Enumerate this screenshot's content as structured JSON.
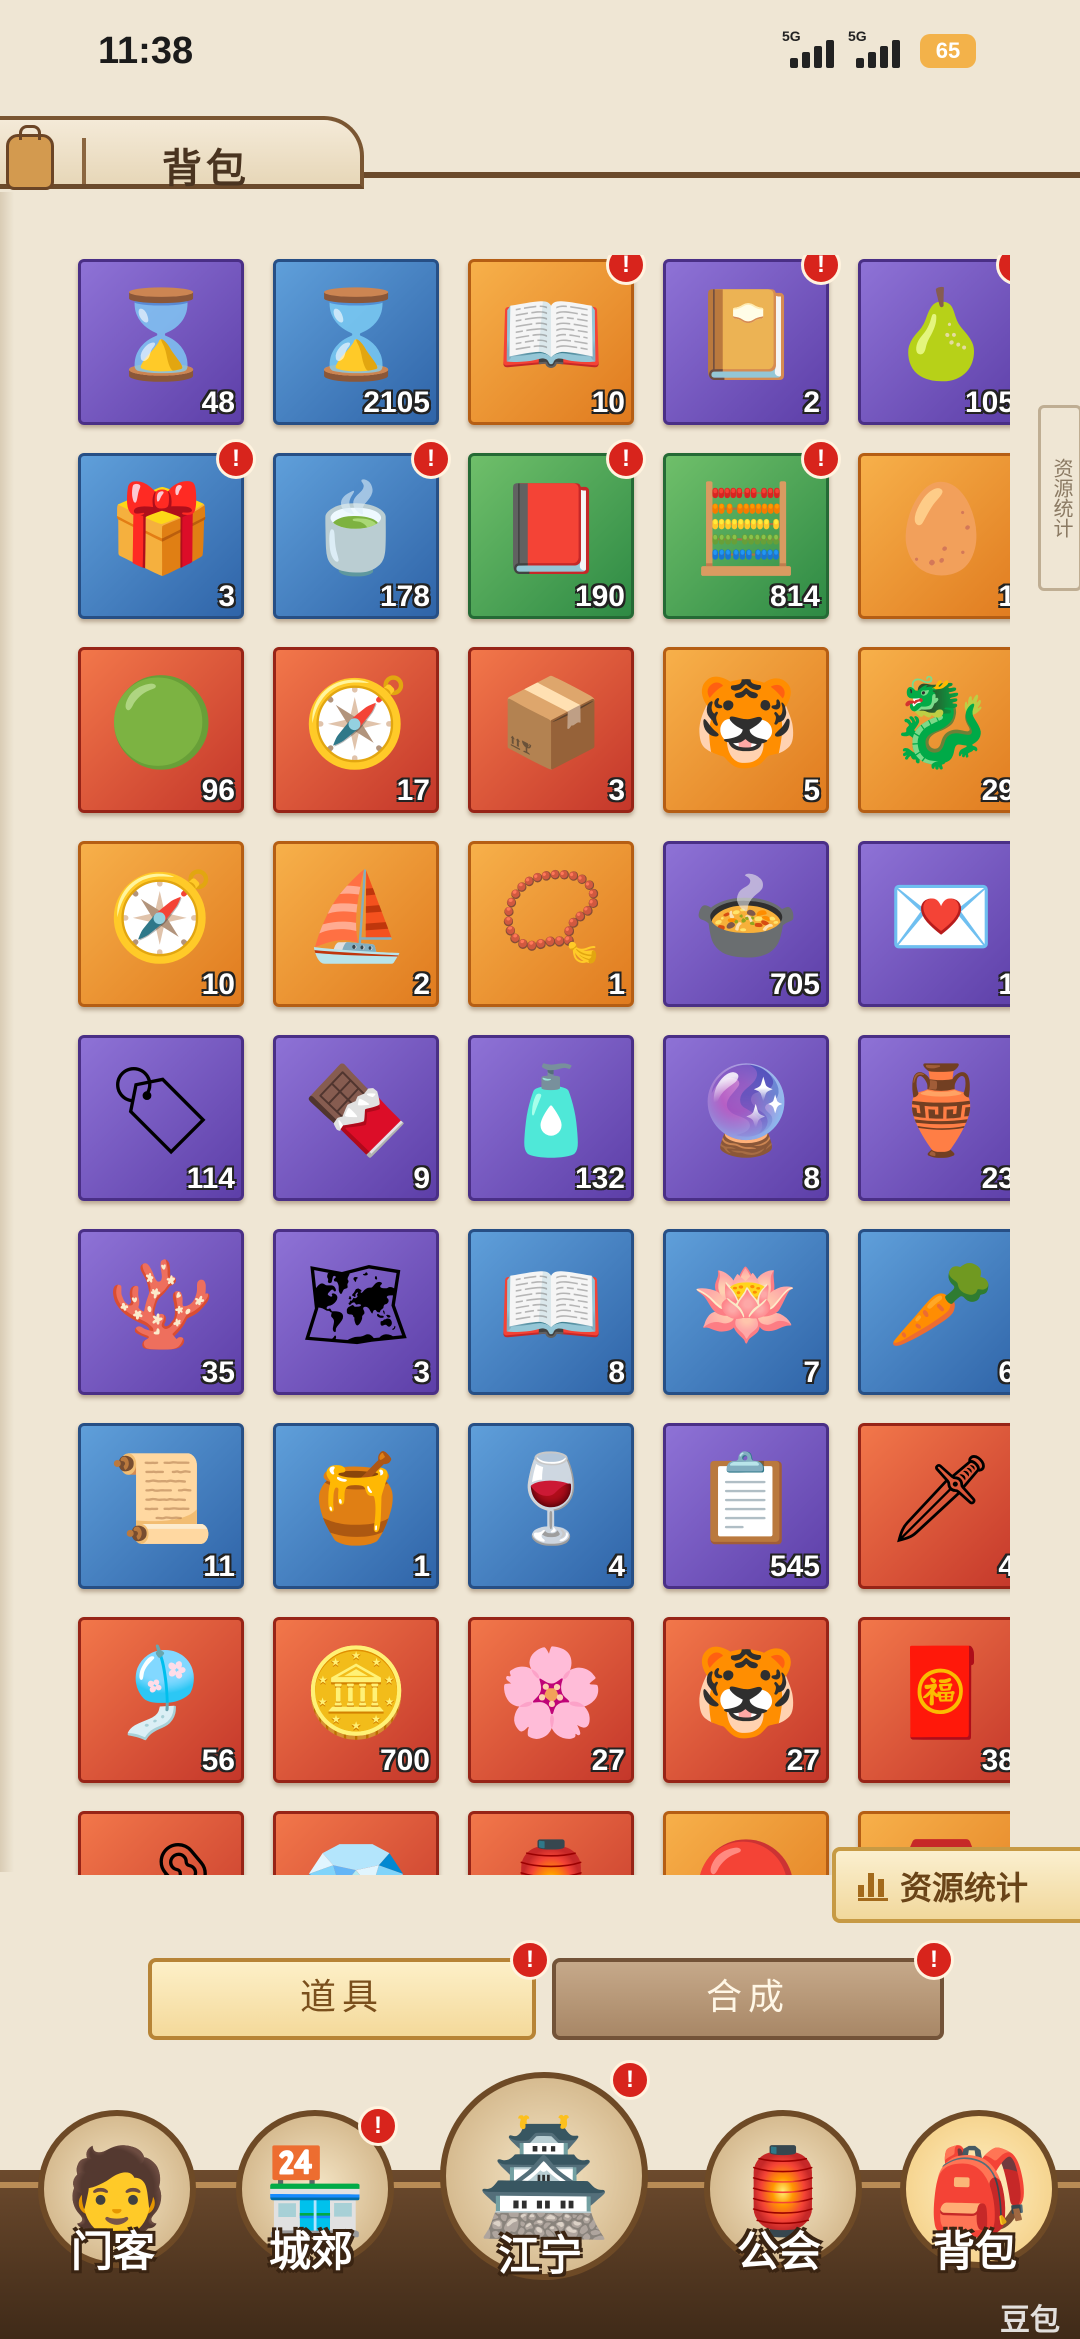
{
  "status_bar": {
    "time": "11:38",
    "network1": "5G",
    "network2": "5G",
    "battery": "65"
  },
  "header": {
    "title": "背包"
  },
  "side_rail": {
    "text": "资源统计"
  },
  "items": [
    {
      "icon": "hourglass-card",
      "color": "purple",
      "count": "48",
      "alert": false
    },
    {
      "icon": "hourglass-card",
      "color": "blue",
      "count": "2105",
      "alert": false
    },
    {
      "icon": "illustrated-book",
      "color": "orange",
      "count": "10",
      "alert": true
    },
    {
      "icon": "mystery-book",
      "color": "purple",
      "count": "2",
      "alert": true
    },
    {
      "icon": "gourd",
      "color": "purple",
      "count": "105",
      "alert": true
    },
    {
      "icon": "gift-box",
      "color": "blue",
      "count": "3",
      "alert": true
    },
    {
      "icon": "tea-bowl",
      "color": "blue",
      "count": "178",
      "alert": true
    },
    {
      "icon": "mystery-tome",
      "color": "green",
      "count": "190",
      "alert": true
    },
    {
      "icon": "abacus",
      "color": "green",
      "count": "814",
      "alert": true
    },
    {
      "icon": "lucky-egg",
      "color": "orange",
      "count": "1",
      "alert": false
    },
    {
      "icon": "jade-disc",
      "color": "red",
      "count": "96",
      "alert": false
    },
    {
      "icon": "compass",
      "color": "red",
      "count": "17",
      "alert": false
    },
    {
      "icon": "seal-box",
      "color": "red",
      "count": "3",
      "alert": false
    },
    {
      "icon": "tiger-pelt",
      "color": "orange",
      "count": "5",
      "alert": false
    },
    {
      "icon": "jade-pendant",
      "color": "orange",
      "count": "29",
      "alert": false
    },
    {
      "icon": "compass",
      "color": "orange",
      "count": "10",
      "alert": false
    },
    {
      "icon": "dragon-boat",
      "color": "orange",
      "count": "2",
      "alert": false
    },
    {
      "icon": "necklace",
      "color": "orange",
      "count": "1",
      "alert": false
    },
    {
      "icon": "soup-bowl",
      "color": "purple",
      "count": "705",
      "alert": false
    },
    {
      "icon": "heart-sign",
      "color": "purple",
      "count": "1",
      "alert": false
    },
    {
      "icon": "token-tag",
      "color": "purple",
      "count": "114",
      "alert": false
    },
    {
      "icon": "tea-packet",
      "color": "purple",
      "count": "9",
      "alert": false
    },
    {
      "icon": "oil-bottle",
      "color": "purple",
      "count": "132",
      "alert": false
    },
    {
      "icon": "pearl",
      "color": "purple",
      "count": "8",
      "alert": false
    },
    {
      "icon": "treasure-pot",
      "color": "purple",
      "count": "23",
      "alert": false
    },
    {
      "icon": "coral",
      "color": "purple",
      "count": "35",
      "alert": false
    },
    {
      "icon": "map",
      "color": "purple",
      "count": "3",
      "alert": false
    },
    {
      "icon": "open-book",
      "color": "blue",
      "count": "8",
      "alert": false
    },
    {
      "icon": "lotus",
      "color": "blue",
      "count": "7",
      "alert": false
    },
    {
      "icon": "ginseng",
      "color": "blue",
      "count": "6",
      "alert": false
    },
    {
      "icon": "scroll",
      "color": "blue",
      "count": "11",
      "alert": false
    },
    {
      "icon": "wine-jar",
      "color": "blue",
      "count": "1",
      "alert": false
    },
    {
      "icon": "wine-bottle",
      "color": "blue",
      "count": "4",
      "alert": false
    },
    {
      "icon": "menu-card",
      "color": "purple",
      "count": "545",
      "alert": false
    },
    {
      "icon": "sword-fountain",
      "color": "red",
      "count": "4",
      "alert": false
    },
    {
      "icon": "jade-ornament",
      "color": "red",
      "count": "56",
      "alert": false
    },
    {
      "icon": "gold-coin",
      "color": "red",
      "count": "700",
      "alert": false
    },
    {
      "icon": "hairpin",
      "color": "red",
      "count": "27",
      "alert": false
    },
    {
      "icon": "tiger-pelt",
      "color": "red",
      "count": "27",
      "alert": false
    },
    {
      "icon": "red-scroll",
      "color": "red",
      "count": "38",
      "alert": false
    },
    {
      "icon": "golden-key",
      "color": "red",
      "count": "",
      "alert": false
    },
    {
      "icon": "perfume-bottle",
      "color": "red",
      "count": "",
      "alert": false
    },
    {
      "icon": "red-charm",
      "color": "red",
      "count": "",
      "alert": false
    },
    {
      "icon": "red-orb",
      "color": "orange",
      "count": "",
      "alert": false
    },
    {
      "icon": "red-parcel",
      "color": "orange",
      "count": "",
      "alert": false
    }
  ],
  "stats_button": {
    "label": "资源统计"
  },
  "tabs": {
    "items": "道具",
    "craft": "合成"
  },
  "nav": [
    {
      "label": "门客",
      "icon": "retainer-portrait",
      "alert": false
    },
    {
      "label": "城郊",
      "icon": "shop-building",
      "alert": true
    },
    {
      "label": "江宁",
      "icon": "city-gate",
      "alert": true
    },
    {
      "label": "公会",
      "icon": "guild-banner",
      "alert": false
    },
    {
      "label": "背包",
      "icon": "backpack",
      "alert": false
    }
  ],
  "watermark": "豆包"
}
